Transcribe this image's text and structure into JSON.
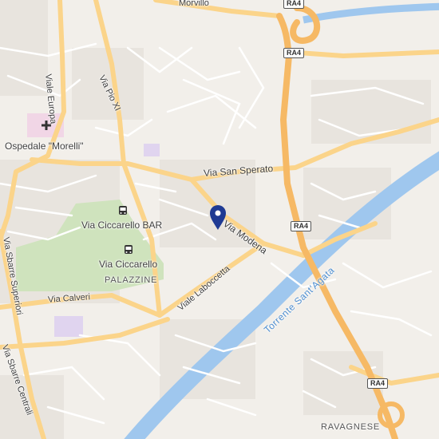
{
  "map": {
    "roads": {
      "via_san_sperato": "Via San Sperato",
      "via_modena": "Via Modena",
      "viale_laboccetta": "Viale Laboccetta",
      "via_calveri": "Via Calveri",
      "via_sbarre_superiori": "Via Sbarre Superiori",
      "via_sbarre_centrali": "Via Sbarre Centrali",
      "viale_europa": "Viale Europa",
      "via_pio_xi": "Via Pio XI",
      "top_partial": "Morvillo"
    },
    "highway": "RA4",
    "places": {
      "hospital": "Ospedale \"Morelli\"",
      "bus_stop_bar": "Via Ciccarello BAR",
      "bus_stop_palazzine": "Via Ciccarello",
      "area_palazzine": "PALAZZINE",
      "area_ravagnese": "RAVAGNESE"
    },
    "water": {
      "river": "Torrente Sant'Agata"
    },
    "colors": {
      "land": "#f2efea",
      "building": "#e6e1da",
      "park": "#cfe3bd",
      "water": "#9fc7ee",
      "major_road": "#fbd48a",
      "highway": "#f6b965",
      "minor_road": "#ffffff",
      "pin": "#1f3a93",
      "hospital": "#f1d6e6",
      "school": "#e0d4ef"
    },
    "icons": {
      "pin": "location-pin-icon",
      "hospital": "hospital-cross-icon",
      "bus": "bus-stop-icon"
    }
  }
}
